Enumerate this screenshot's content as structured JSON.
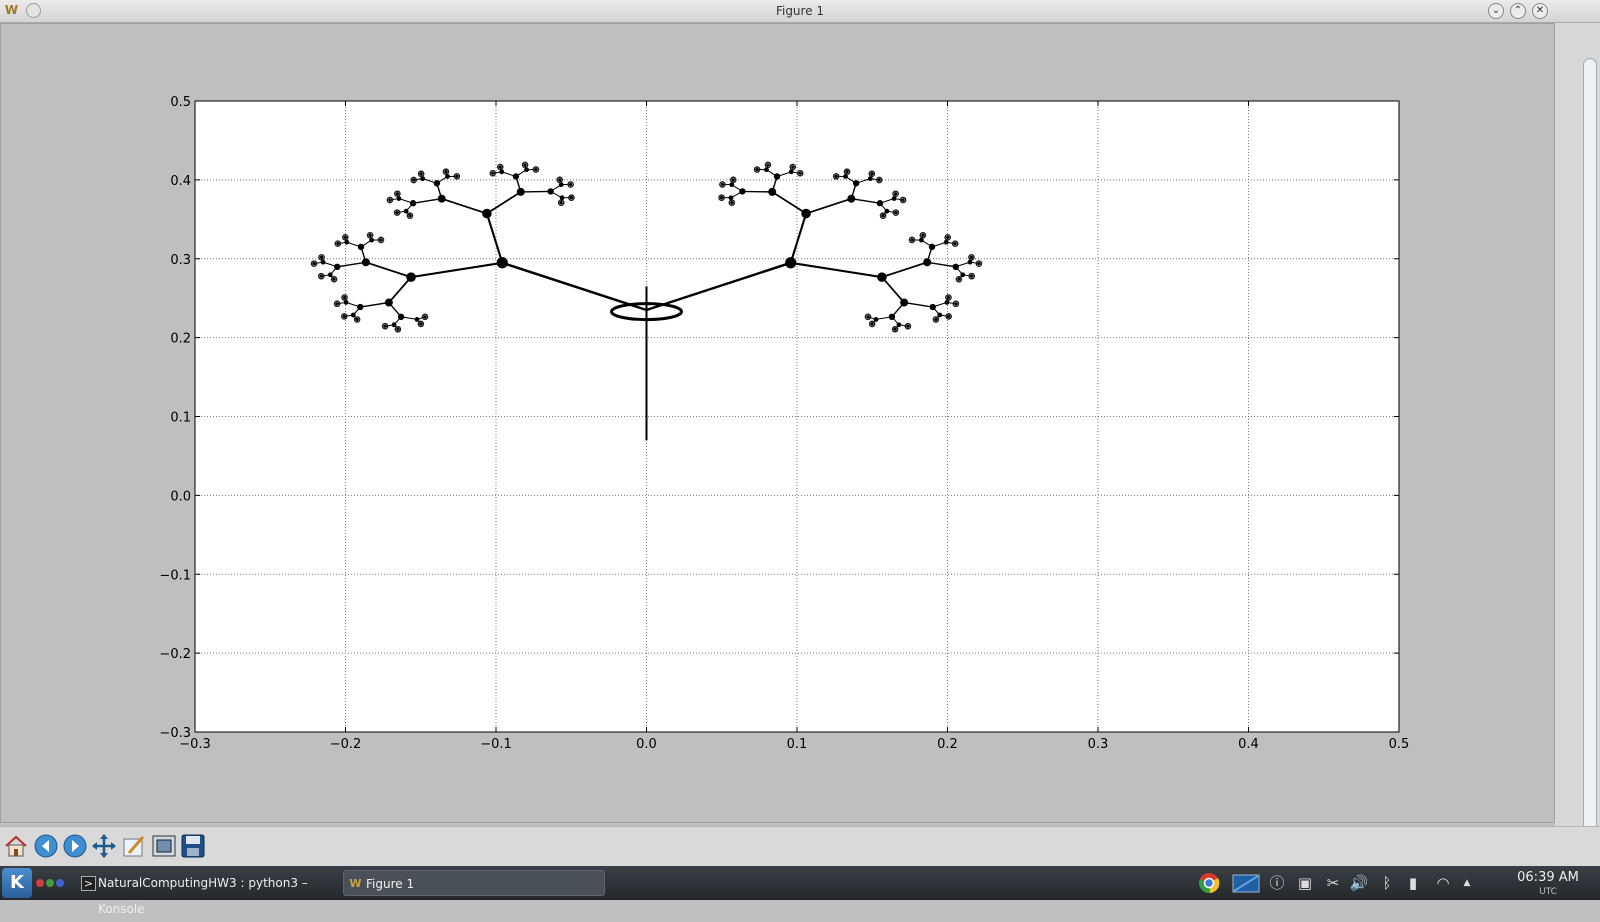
{
  "window": {
    "title": "Figure 1"
  },
  "chart_data": {
    "type": "scatter",
    "title": "",
    "xlabel": "",
    "ylabel": "",
    "xlim": [
      -0.3,
      0.5
    ],
    "ylim": [
      -0.3,
      0.5
    ],
    "grid": true,
    "x_ticks": [
      "−0.3",
      "−0.2",
      "−0.1",
      "0.0",
      "0.1",
      "0.2",
      "0.3",
      "0.4",
      "0.5"
    ],
    "y_ticks": [
      "0.5",
      "0.4",
      "0.3",
      "0.2",
      "0.1",
      "0.0",
      "−0.1",
      "−0.2",
      "−0.3"
    ],
    "series": [
      {
        "color": "#000000",
        "description_points": "branching fractal tree (symmetric about x=0)",
        "trunk": {
          "x": 0.0,
          "y": [
            0.07,
            0.265
          ]
        },
        "branch_nodes": [
          {
            "x": 0.0,
            "y": 0.235
          },
          {
            "x": -0.096,
            "y": 0.295
          },
          {
            "x": 0.096,
            "y": 0.295
          },
          {
            "x": -0.165,
            "y": 0.283
          },
          {
            "x": 0.165,
            "y": 0.283
          },
          {
            "x": -0.084,
            "y": 0.365
          },
          {
            "x": 0.084,
            "y": 0.365
          },
          {
            "x": -0.19,
            "y": 0.32
          },
          {
            "x": 0.19,
            "y": 0.32
          },
          {
            "x": -0.19,
            "y": 0.25
          },
          {
            "x": 0.19,
            "y": 0.25
          },
          {
            "x": -0.12,
            "y": 0.39
          },
          {
            "x": 0.12,
            "y": 0.39
          },
          {
            "x": -0.05,
            "y": 0.39
          },
          {
            "x": 0.05,
            "y": 0.39
          }
        ]
      }
    ]
  },
  "toolbar": {
    "buttons": [
      "home-icon",
      "back-icon",
      "forward-icon",
      "pan-icon",
      "configure-subplots-icon",
      "zoom-icon",
      "save-icon"
    ]
  },
  "taskbar": {
    "tasks": [
      {
        "label": "NaturalComputingHW3 : python3 – Konsole"
      },
      {
        "label": "Figure 1"
      }
    ],
    "clock": {
      "time": "06:39 AM",
      "tz": "UTC"
    }
  }
}
